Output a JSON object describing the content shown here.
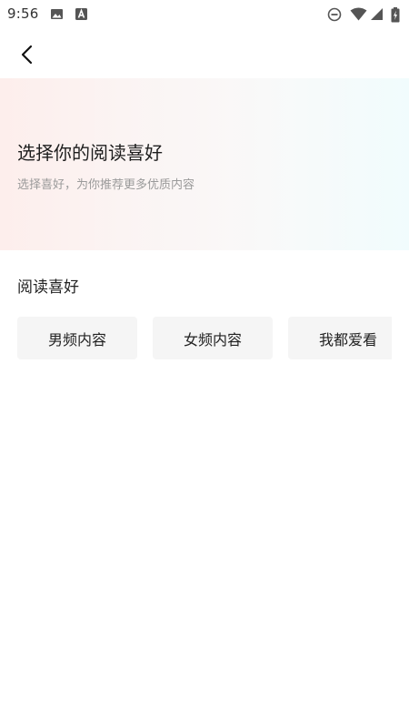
{
  "status_bar": {
    "time": "9:56",
    "icons": [
      "image-icon",
      "font-a-icon",
      "do-not-disturb-icon",
      "wifi-icon",
      "cellular-signal-icon",
      "battery-charging-icon"
    ]
  },
  "toolbar": {
    "back_icon": "chevron-left-icon"
  },
  "header": {
    "title": "选择你的阅读喜好",
    "subtitle": "选择喜好，为你推荐更多优质内容",
    "gradient_colors": [
      "#fdeeec",
      "#f9f9f9",
      "#f1fcfd"
    ]
  },
  "section": {
    "title": "阅读喜好",
    "options": [
      {
        "label": "男频内容"
      },
      {
        "label": "女频内容"
      },
      {
        "label": "我都爱看"
      }
    ]
  }
}
